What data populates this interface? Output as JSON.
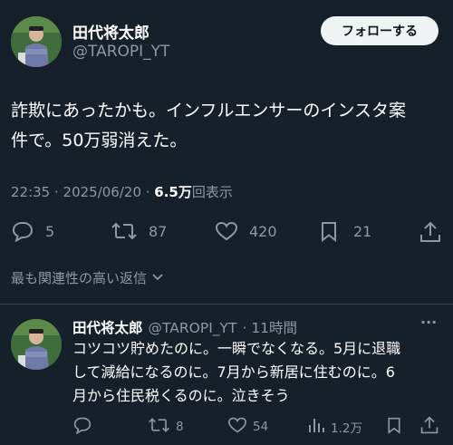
{
  "tweet": {
    "author_name": "田代将太郎",
    "author_handle": "@TAROPI_YT",
    "follow_label": "フォローする",
    "text_line1": "詐欺にあったかも。インフルエンサーのインスタ案",
    "text_line2": "件で。50万弱消えた。",
    "timestamp": "22:35 · 2025/06/20 · ",
    "views_count": "6.5万",
    "views_label": "回表示",
    "replies": "5",
    "retweets": "87",
    "likes": "420",
    "bookmarks": "21"
  },
  "sort": {
    "label": "最も関連性の高い返信"
  },
  "reply": {
    "author_name": "田代将太郎",
    "author_handle": "@TAROPI_YT",
    "time_ago": "· 11時間",
    "more": "···",
    "text_line1": "コツコツ貯めたのに。一瞬でなくなる。5月に退職",
    "text_line2": "して減給になるのに。7月から新居に住むのに。6",
    "text_line3": "月から住民税くるのに。泣きそう",
    "retweets": "8",
    "likes": "54",
    "views": "1.2万"
  },
  "colors": {
    "background": "#15202b",
    "text_secondary": "#8b98a5",
    "divider": "#38444d",
    "button_bg": "#eff3f4"
  }
}
